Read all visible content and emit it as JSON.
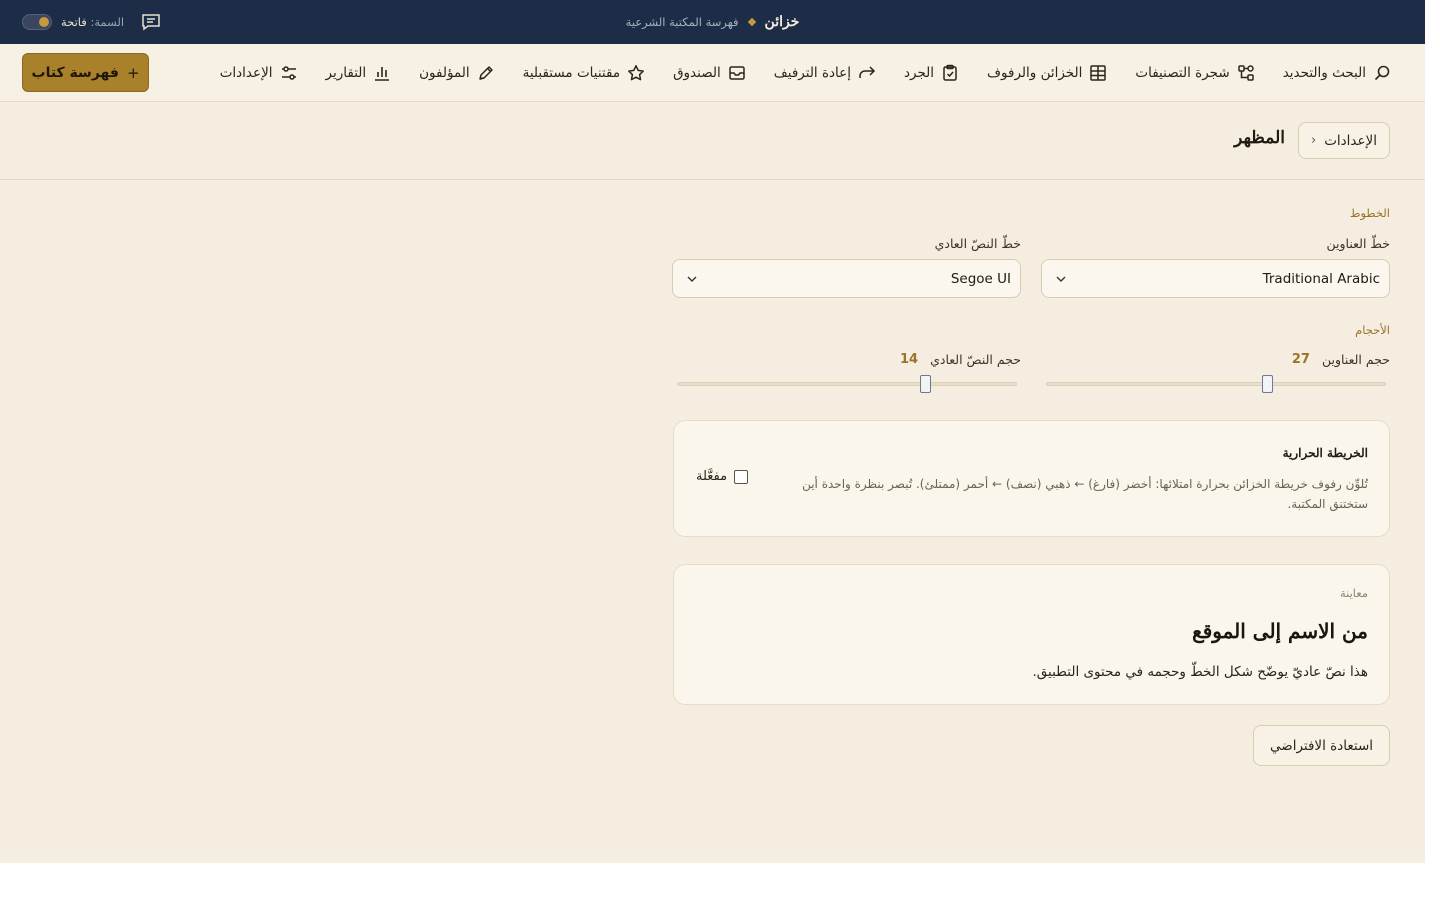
{
  "titlebar": {
    "app_name": "خزائن",
    "subtitle": "فهرسة المكتبة الشرعية",
    "theme_prefix": "السمة:",
    "theme_value": "فاتحة",
    "theme_is_light": true
  },
  "nav": {
    "items": [
      {
        "label": "البحث والتحديد",
        "icon": "search-icon"
      },
      {
        "label": "شجرة التصنيفات",
        "icon": "tree-icon"
      },
      {
        "label": "الخزائن والرفوف",
        "icon": "grid-icon"
      },
      {
        "label": "الجرد",
        "icon": "clipboard-icon"
      },
      {
        "label": "إعادة الترفيف",
        "icon": "redo-arrow-icon"
      },
      {
        "label": "الصندوق",
        "icon": "inbox-icon"
      },
      {
        "label": "مقتنيات مستقبلية",
        "icon": "star-icon"
      },
      {
        "label": "المؤلفون",
        "icon": "pen-icon"
      },
      {
        "label": "التقارير",
        "icon": "bar-chart-icon"
      },
      {
        "label": "الإعدادات",
        "icon": "sliders-icon"
      }
    ],
    "add_book_label": "فهرسة كتاب",
    "add_book_icon": "plus-icon"
  },
  "header": {
    "title": "المظهر",
    "back_label": "الإعدادات",
    "back_icon": "chevron-left-icon"
  },
  "fonts": {
    "section_label": "الخطوط",
    "heading_font_label": "خطّ العناوين",
    "heading_font_value": "Traditional Arabic",
    "body_font_label": "خطّ النصّ العادي",
    "body_font_value": "Segoe UI"
  },
  "sizes": {
    "section_label": "الأحجام",
    "heading_size_label": "حجم العناوين",
    "heading_size_value": "27",
    "heading_size_fraction": 0.65,
    "body_size_label": "حجم النصّ العادي",
    "body_size_value": "14",
    "body_size_fraction": 0.73
  },
  "heatmap": {
    "title": "الخريطة الحرارية",
    "description": "تُلوِّن رفوف خريطة الخزائن بحرارة امتلائها: أخضر (فارغ) ← ذهبي (نصف) ← أحمر (ممتلئ). تُبصر بنظرة واحدة أين ستختنق المكتبة.",
    "toggle_label": "مفعَّلة",
    "enabled": false
  },
  "preview": {
    "label": "معاينة",
    "heading": "من الاسم إلى الموقع",
    "body": "هذا نصّ عاديّ يوضّح شكل الخطّ وحجمه في محتوى التطبيق."
  },
  "restore_label": "استعادة الافتراضي",
  "colors": {
    "titlebar_bg": "#1e2d47",
    "page_bg": "#f4ede0",
    "accent_gold": "#a9812a",
    "label_gold": "#9a7428"
  }
}
